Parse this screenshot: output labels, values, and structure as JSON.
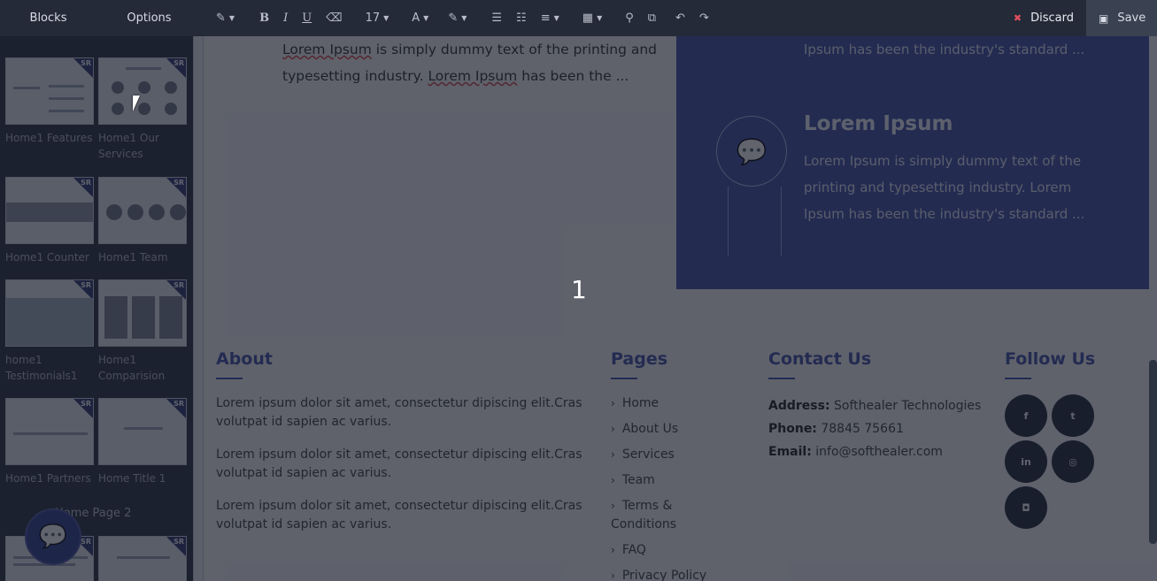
{
  "toolbar": {
    "blocks_tab": "Blocks",
    "options_tab": "Options",
    "font_size": "17",
    "discard_label": "Discard",
    "save_label": "Save",
    "tools": [
      {
        "name": "magic-icon",
        "glyph": "✎",
        "caret": true
      },
      {
        "name": "bold-icon",
        "glyph": "B"
      },
      {
        "name": "italic-icon",
        "glyph": "I"
      },
      {
        "name": "underline-icon",
        "glyph": "U"
      },
      {
        "name": "eraser-icon",
        "glyph": "⌫"
      },
      {
        "name": "font-color-icon",
        "glyph": "A",
        "caret": true
      },
      {
        "name": "brush-icon",
        "glyph": "✎",
        "caret": true
      },
      {
        "name": "bullet-list-icon",
        "glyph": "☰"
      },
      {
        "name": "numbered-list-icon",
        "glyph": "☷"
      },
      {
        "name": "align-icon",
        "glyph": "≡",
        "caret": true
      },
      {
        "name": "table-icon",
        "glyph": "▦",
        "caret": true
      },
      {
        "name": "link-icon",
        "glyph": "⚲"
      },
      {
        "name": "image-icon",
        "glyph": "⧉"
      },
      {
        "name": "undo-icon",
        "glyph": "↶"
      },
      {
        "name": "redo-icon",
        "glyph": "↷"
      }
    ]
  },
  "sidebar": {
    "partial_label_top": "Home1",
    "blocks": [
      {
        "label": "Home1 Features"
      },
      {
        "label": "Home1 Our Services"
      },
      {
        "label": "Home1 Counter"
      },
      {
        "label": "Home1 Team"
      },
      {
        "label": "home1 Testimonials1"
      },
      {
        "label": "Home1 Comparision"
      },
      {
        "label": "Home1 Partners"
      },
      {
        "label": "Home Title 1"
      }
    ],
    "section_title": "Home Page 2",
    "badge": "SR"
  },
  "canvas": {
    "hero_text_1": "Lorem Ipsum",
    "hero_text_2": " is simply dummy text of the printing and typesetting industry. ",
    "hero_text_3": "Lorem Ipsum",
    "hero_text_4": " has been the ...",
    "panel_top_text": "Ipsum has been the industry's standard ...",
    "panel_title": "Lorem Ipsum",
    "panel_body": "Lorem Ipsum is simply dummy text of the printing and typesetting industry. Lorem Ipsum has been the industry's standard ...",
    "overlay_number": "1"
  },
  "footer": {
    "about": {
      "title": "About",
      "paragraphs": [
        "Lorem ipsum dolor sit amet, consectetur dipiscing elit.Cras volutpat id sapien ac varius.",
        "Lorem ipsum dolor sit amet, consectetur dipiscing elit.Cras volutpat id sapien ac varius.",
        "Lorem ipsum dolor sit amet, consectetur dipiscing elit.Cras volutpat id sapien ac varius."
      ]
    },
    "pages": {
      "title": "Pages",
      "links": [
        "Home",
        "About Us",
        "Services",
        "Team",
        "Terms & Conditions",
        "FAQ",
        "Privacy Policy"
      ]
    },
    "contact": {
      "title": "Contact Us",
      "address_label": "Address:",
      "address_value": "Softhealer Technologies",
      "phone_label": "Phone:",
      "phone_value": "78845 75661",
      "email_label": "Email:",
      "email_value": "info@softhealer.com"
    },
    "follow": {
      "title": "Follow Us",
      "icons": [
        {
          "name": "facebook-icon",
          "glyph": "f"
        },
        {
          "name": "twitter-icon",
          "glyph": "t"
        },
        {
          "name": "linkedin-icon",
          "glyph": "in"
        },
        {
          "name": "github-icon",
          "glyph": "◎"
        },
        {
          "name": "instagram-icon",
          "glyph": "◘"
        }
      ]
    }
  },
  "colors": {
    "brand_blue": "#3f4ea8",
    "toolbar_bg": "#242a38",
    "sidebar_bg": "#2b3142",
    "discard_red": "#e04f5f"
  }
}
